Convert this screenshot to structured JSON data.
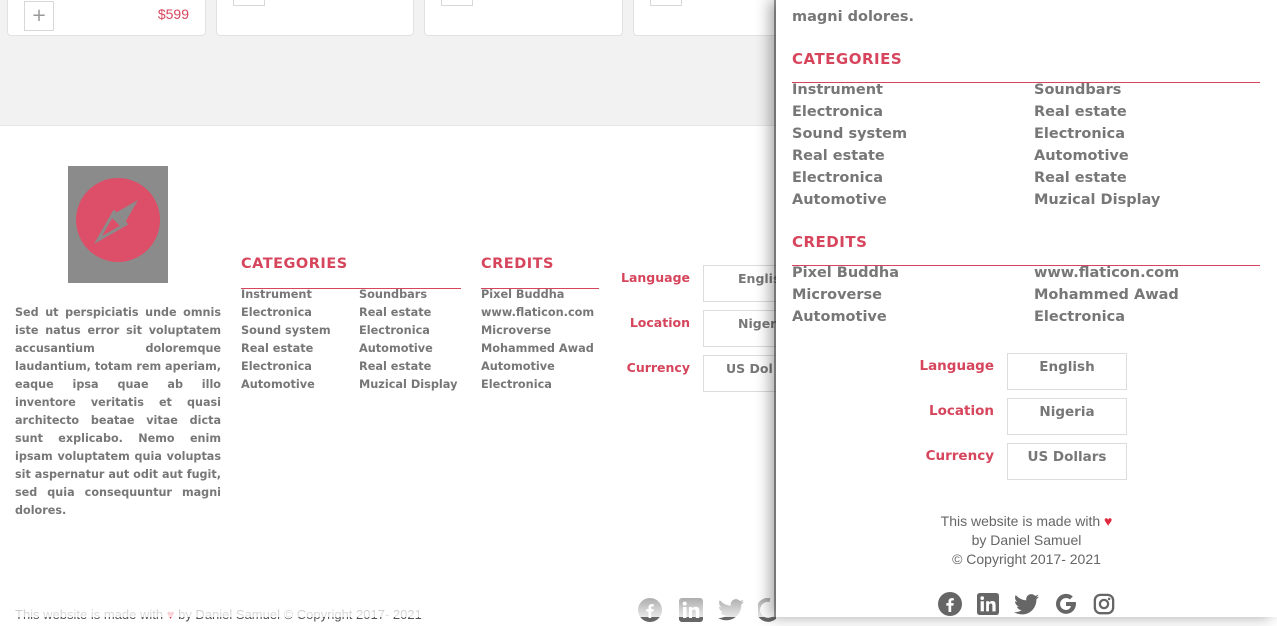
{
  "product_cards": [
    {
      "add_icon": "plus-icon",
      "add_label": "+",
      "price": "$599"
    },
    {
      "add_icon": "plus-icon"
    },
    {
      "add_icon": "plus-icon"
    },
    {
      "add_icon": "plus-icon"
    }
  ],
  "footer": {
    "about": "Sed ut perspiciatis unde omnis iste natus error sit voluptatem accusantium doloremque laudantium, totam rem aperiam, eaque ipsa quae ab illo inventore veritatis et quasi architecto beatae vitae dicta sunt explicabo. Nemo enim ipsam voluptatem quia voluptas sit aspernatur aut odit aut fugit, sed quia consequuntur magni dolores.",
    "categories": {
      "title": "CATEGORIES",
      "col1": [
        "Instrument",
        "Electronica",
        "Sound system",
        "Real estate",
        "Electronica",
        "Automotive"
      ],
      "col2": [
        "Soundbars",
        "Real estate",
        "Electronica",
        "Automotive",
        "Real estate",
        "Muzical Display"
      ]
    },
    "credits": {
      "title": "CREDITS",
      "items": [
        "Pixel Buddha",
        "www.flaticon.com",
        "Microverse",
        "Mohammed Awad",
        "Automotive",
        "Electronica"
      ]
    },
    "selectors": [
      {
        "label": "Language",
        "value": "Englis"
      },
      {
        "label": "Location",
        "value": "Niger"
      },
      {
        "label": "Currency",
        "value": "US Dol"
      }
    ],
    "made_text": "This website is made with",
    "heart": "♥",
    "author_text": "by Daniel Samuel © Copyright 2017- 2021",
    "socials": [
      "facebook-icon",
      "linkedin-icon",
      "twitter-icon",
      "google-icon"
    ]
  },
  "panel": {
    "top_text": "magni dolores.",
    "categories": {
      "title": "CATEGORIES",
      "col1": [
        "Instrument",
        "Electronica",
        "Sound system",
        "Real estate",
        "Electronica",
        "Automotive"
      ],
      "col2": [
        "Soundbars",
        "Real estate",
        "Electronica",
        "Automotive",
        "Real estate",
        "Muzical Display"
      ]
    },
    "credits": {
      "title": "CREDITS",
      "col1": [
        "Pixel Buddha",
        "Microverse",
        "Automotive"
      ],
      "col2": [
        "www.flaticon.com",
        "Mohammed Awad",
        "Electronica"
      ]
    },
    "selectors": [
      {
        "label": "Language",
        "value": "English"
      },
      {
        "label": "Location",
        "value": "Nigeria"
      },
      {
        "label": "Currency",
        "value": "US Dollars"
      }
    ],
    "made_text": "This website is made with",
    "heart": "♥",
    "author": "by Daniel Samuel",
    "copyright": "© Copyright 2017- 2021",
    "socials": [
      "facebook-icon",
      "linkedin-icon",
      "twitter-icon",
      "google-icon",
      "instagram-icon"
    ]
  },
  "colors": {
    "accent": "#d6455c",
    "heart": "#e02a3d",
    "logo_bg": "#8b8b8b",
    "logo_circle": "#dd4f68",
    "text": "#777777"
  }
}
